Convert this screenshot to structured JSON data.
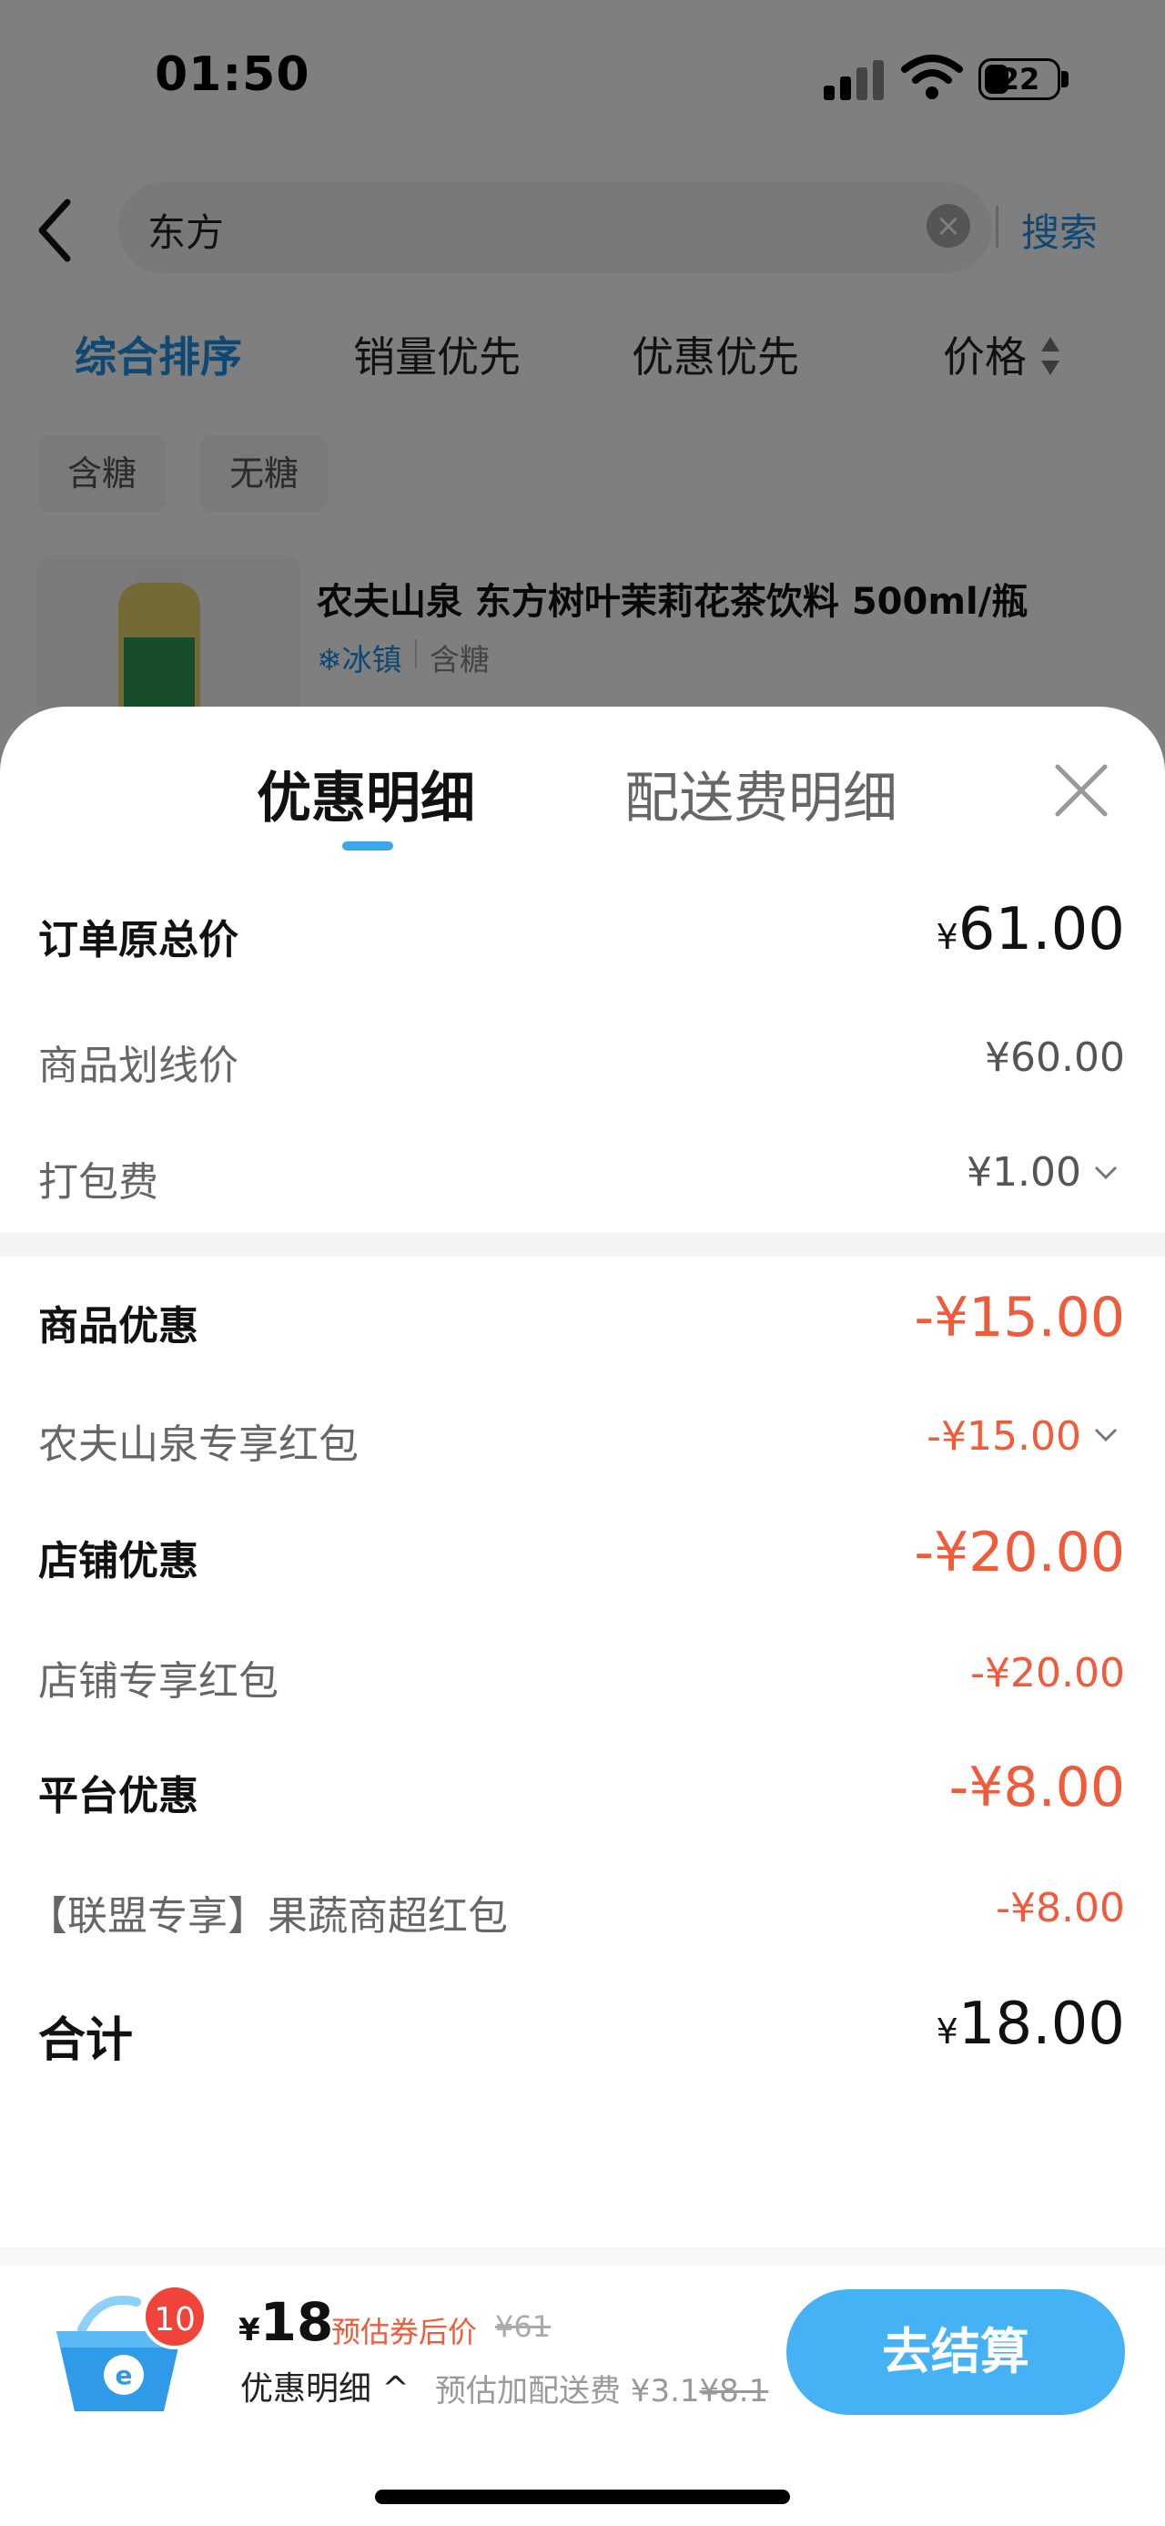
{
  "status_bar": {
    "time": "01:50",
    "battery": "22"
  },
  "search": {
    "query": "东方",
    "button": "搜索"
  },
  "sort_tabs": [
    "综合排序",
    "销量优先",
    "优惠优先",
    "价格"
  ],
  "filter_chips": [
    "含糖",
    "无糖"
  ],
  "product": {
    "title": "农夫山泉 东方树叶茉莉花茶饮料 500ml/瓶",
    "tag_cold": "❄冰镇",
    "tag_sugar": "含糖"
  },
  "sheet": {
    "tabs": [
      "优惠明细",
      "配送费明细"
    ],
    "rows": {
      "original_total": {
        "label": "订单原总价",
        "yen": "¥",
        "value": "61.00"
      },
      "strikethrough_price": {
        "label": "商品划线价",
        "value": "¥60.00"
      },
      "packing_fee": {
        "label": "打包费",
        "value": "¥1.00"
      },
      "product_discount": {
        "label": "商品优惠",
        "value": "-¥15.00"
      },
      "nongfu_redpack": {
        "label": "农夫山泉专享红包",
        "value": "-¥15.00"
      },
      "store_discount": {
        "label": "店铺优惠",
        "value": "-¥20.00"
      },
      "store_redpack": {
        "label": "店铺专享红包",
        "value": "-¥20.00"
      },
      "platform_discount": {
        "label": "平台优惠",
        "value": "-¥8.00"
      },
      "alliance_redpack": {
        "label": "【联盟专享】果蔬商超红包",
        "value": "-¥8.00"
      },
      "total": {
        "label": "合计",
        "yen": "¥",
        "value": "18.00"
      }
    }
  },
  "bottom_bar": {
    "cart_count": "10",
    "price_yen": "¥",
    "price": "18",
    "estimate_label": "预估券后价",
    "original_price": "¥61",
    "detail_toggle": "优惠明细 ^",
    "delivery_prefix": "预估加配送费 ¥3.1",
    "delivery_original": "¥8.1",
    "checkout": "去结算"
  },
  "colors": {
    "accent": "#1e90e6",
    "discount_red": "#ef5b3b",
    "checkout_blue": "#45b2f5"
  }
}
